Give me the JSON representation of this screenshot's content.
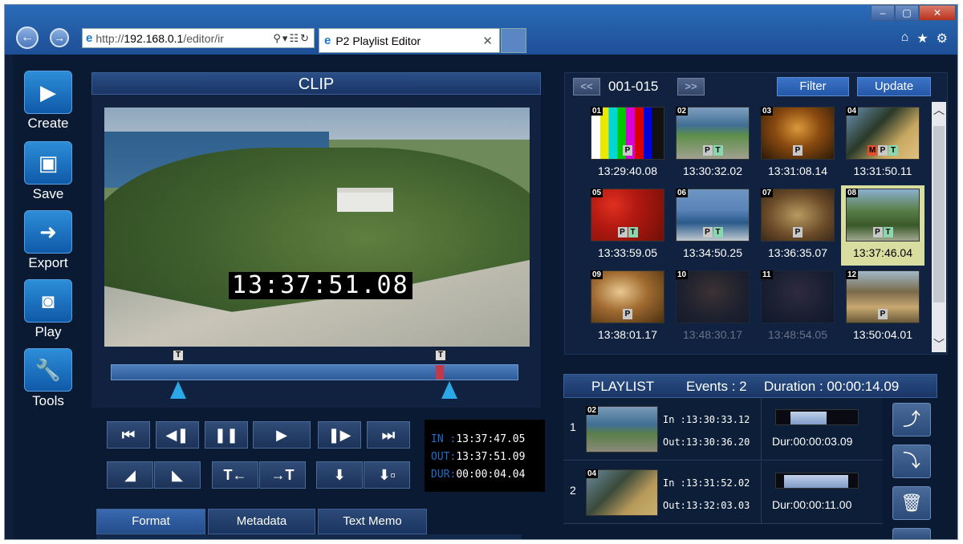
{
  "browser": {
    "address_proto": "http://",
    "address_host": "192.168.0.1",
    "address_path": "/editor/ir",
    "tab_title": "P2 Playlist Editor"
  },
  "sidebar": {
    "items": [
      {
        "label": "Create"
      },
      {
        "label": "Save"
      },
      {
        "label": "Export"
      },
      {
        "label": "Play"
      },
      {
        "label": "Tools"
      }
    ]
  },
  "clip": {
    "title": "CLIP",
    "timecode": "13:37:51.08",
    "in_label": "IN :",
    "in_value": "13:37:47.05",
    "out_label": "OUT:",
    "out_value": "13:37:51.09",
    "dur_label": "DUR:",
    "dur_value": "00:00:04.04",
    "marker_label": "T"
  },
  "tabs": {
    "format": "Format",
    "metadata": "Metadata",
    "textmemo": "Text Memo"
  },
  "browser_panel": {
    "prev": "<<",
    "next": ">>",
    "range": "001-015",
    "filter": "Filter",
    "update": "Update"
  },
  "thumbs": [
    {
      "num": "01",
      "tc": "13:29:40.08",
      "badges": [
        "P"
      ]
    },
    {
      "num": "02",
      "tc": "13:30:32.02",
      "badges": [
        "P",
        "T"
      ]
    },
    {
      "num": "03",
      "tc": "13:31:08.14",
      "badges": [
        "P"
      ]
    },
    {
      "num": "04",
      "tc": "13:31:50.11",
      "badges": [
        "M",
        "P",
        "T"
      ]
    },
    {
      "num": "05",
      "tc": "13:33:59.05",
      "badges": [
        "P",
        "T"
      ]
    },
    {
      "num": "06",
      "tc": "13:34:50.25",
      "badges": [
        "P",
        "T"
      ]
    },
    {
      "num": "07",
      "tc": "13:36:35.07",
      "badges": [
        "P"
      ]
    },
    {
      "num": "08",
      "tc": "13:37:46.04",
      "badges": [
        "P",
        "T"
      ]
    },
    {
      "num": "09",
      "tc": "13:38:01.17",
      "badges": [
        "P"
      ]
    },
    {
      "num": "10",
      "tc": "13:48:30.17",
      "badges": []
    },
    {
      "num": "11",
      "tc": "13:48:54.05",
      "badges": []
    },
    {
      "num": "12",
      "tc": "13:50:04.01",
      "badges": [
        "P"
      ]
    }
  ],
  "playlist": {
    "title": "PLAYLIST",
    "events": "Events : 2",
    "duration": "Duration : 00:00:14.09",
    "rows": [
      {
        "index": "1",
        "num": "02",
        "in": "In  :13:30:33.12",
        "out": "Out:13:30:36.20",
        "dur": "Dur:00:00:03.09",
        "fill": 0.45
      },
      {
        "index": "2",
        "num": "04",
        "in": "In  :13:31:52.02",
        "out": "Out:13:32:03.03",
        "dur": "Dur:00:00:11.00",
        "fill": 0.8
      }
    ]
  },
  "colors": {
    "accent": "#2d8ed8",
    "background": "#0a1a33",
    "selected_thumb": "#d8dea0"
  }
}
